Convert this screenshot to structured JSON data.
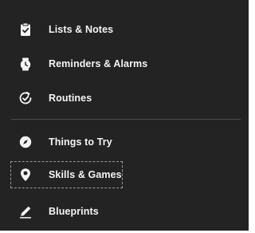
{
  "menu": {
    "items": [
      {
        "label": "Lists & Notes",
        "icon": "clipboard-check-icon"
      },
      {
        "label": "Reminders & Alarms",
        "icon": "alarm-clock-icon"
      },
      {
        "label": "Routines",
        "icon": "routines-check-icon"
      },
      {
        "label": "Things to Try",
        "icon": "compass-icon"
      },
      {
        "label": "Skills & Games",
        "icon": "location-pin-icon"
      },
      {
        "label": "Blueprints",
        "icon": "pencil-icon"
      }
    ]
  },
  "colors": {
    "background": "#232323",
    "text": "#f4f4f4",
    "divider": "#4a4a4a",
    "focus_outline": "#9a9a9a"
  }
}
